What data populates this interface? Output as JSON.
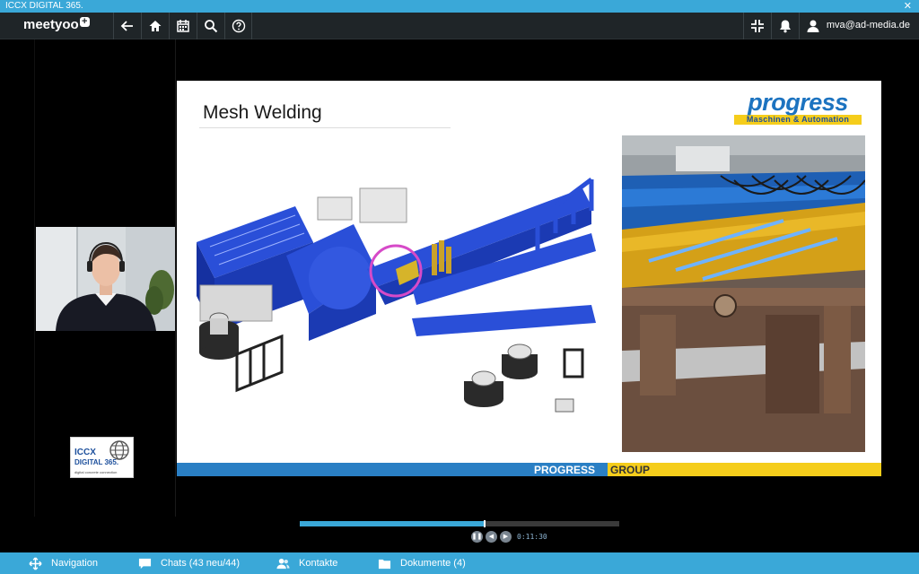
{
  "window": {
    "title": "ICCX DIGITAL 365.",
    "close_glyph": "✕"
  },
  "topbar": {
    "logo_text": "meetyoo",
    "logo_plus": "+",
    "nav_icons": [
      "back-arrow-icon",
      "home-icon",
      "calendar-icon",
      "search-icon",
      "help-icon"
    ],
    "right_icons": [
      "fullscreen-exit-icon",
      "bell-icon",
      "user-icon"
    ],
    "user_email": "mva@ad-media.de"
  },
  "sidebar": {
    "logo_line1": "ICCX",
    "logo_line2": "DIGITAL 365.",
    "logo_tagline": "digital concrete connection"
  },
  "slide": {
    "title": "Mesh Welding",
    "brand_word": "progress",
    "brand_sub": "Maschinen & Automation",
    "footer_left": "PROGRESS",
    "footer_right": "GROUP",
    "colors": {
      "blue": "#2a7fc4",
      "yellow": "#f5cd1b"
    }
  },
  "player": {
    "progress": 0.58,
    "time": "0:11:30",
    "controls": [
      "pause-icon",
      "rewind-icon",
      "forward-icon"
    ]
  },
  "bottombar": {
    "items": [
      {
        "icon": "move-icon",
        "label": "Navigation"
      },
      {
        "icon": "chat-icon",
        "label": "Chats (43 neu/44)"
      },
      {
        "icon": "contacts-icon",
        "label": "Kontakte"
      },
      {
        "icon": "folder-icon",
        "label": "Dokumente (4)"
      }
    ]
  }
}
